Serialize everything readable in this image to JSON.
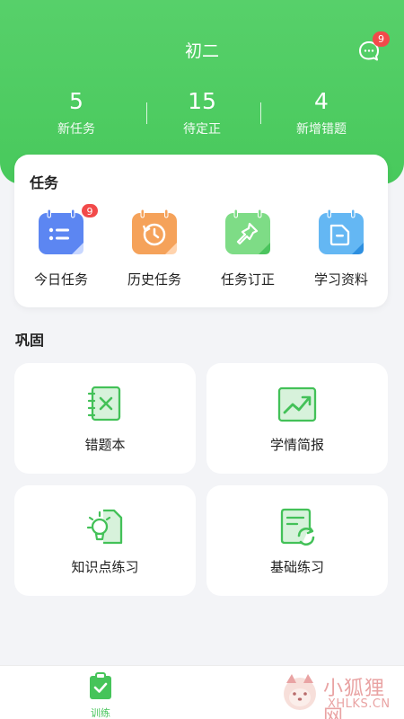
{
  "header": {
    "title": "初二",
    "message_badge": "9",
    "stats": [
      {
        "value": "5",
        "label": "新任务"
      },
      {
        "value": "15",
        "label": "待定正"
      },
      {
        "value": "4",
        "label": "新增错题"
      }
    ]
  },
  "tasks": {
    "title": "任务",
    "items": [
      {
        "label": "今日任务",
        "badge": "9",
        "icon": "calendar-list-icon",
        "color": "#5c86f2"
      },
      {
        "label": "历史任务",
        "icon": "calendar-history-icon",
        "color": "#f5a25a"
      },
      {
        "label": "任务订正",
        "icon": "calendar-pin-icon",
        "color": "#7edc86"
      },
      {
        "label": "学习资料",
        "icon": "calendar-folder-icon",
        "color": "#64b7f3"
      }
    ]
  },
  "consolidate": {
    "title": "巩固",
    "tiles": [
      {
        "label": "错题本",
        "icon": "wrong-book-icon"
      },
      {
        "label": "学情简报",
        "icon": "trend-chart-icon"
      },
      {
        "label": "知识点练习",
        "icon": "lightbulb-doc-icon"
      },
      {
        "label": "基础练习",
        "icon": "refresh-doc-icon"
      }
    ],
    "accent": "#43c158"
  },
  "tabbar": {
    "active_label": "训练"
  },
  "watermark": {
    "cn": "小狐狸网",
    "en": "XHLKS.CN"
  }
}
